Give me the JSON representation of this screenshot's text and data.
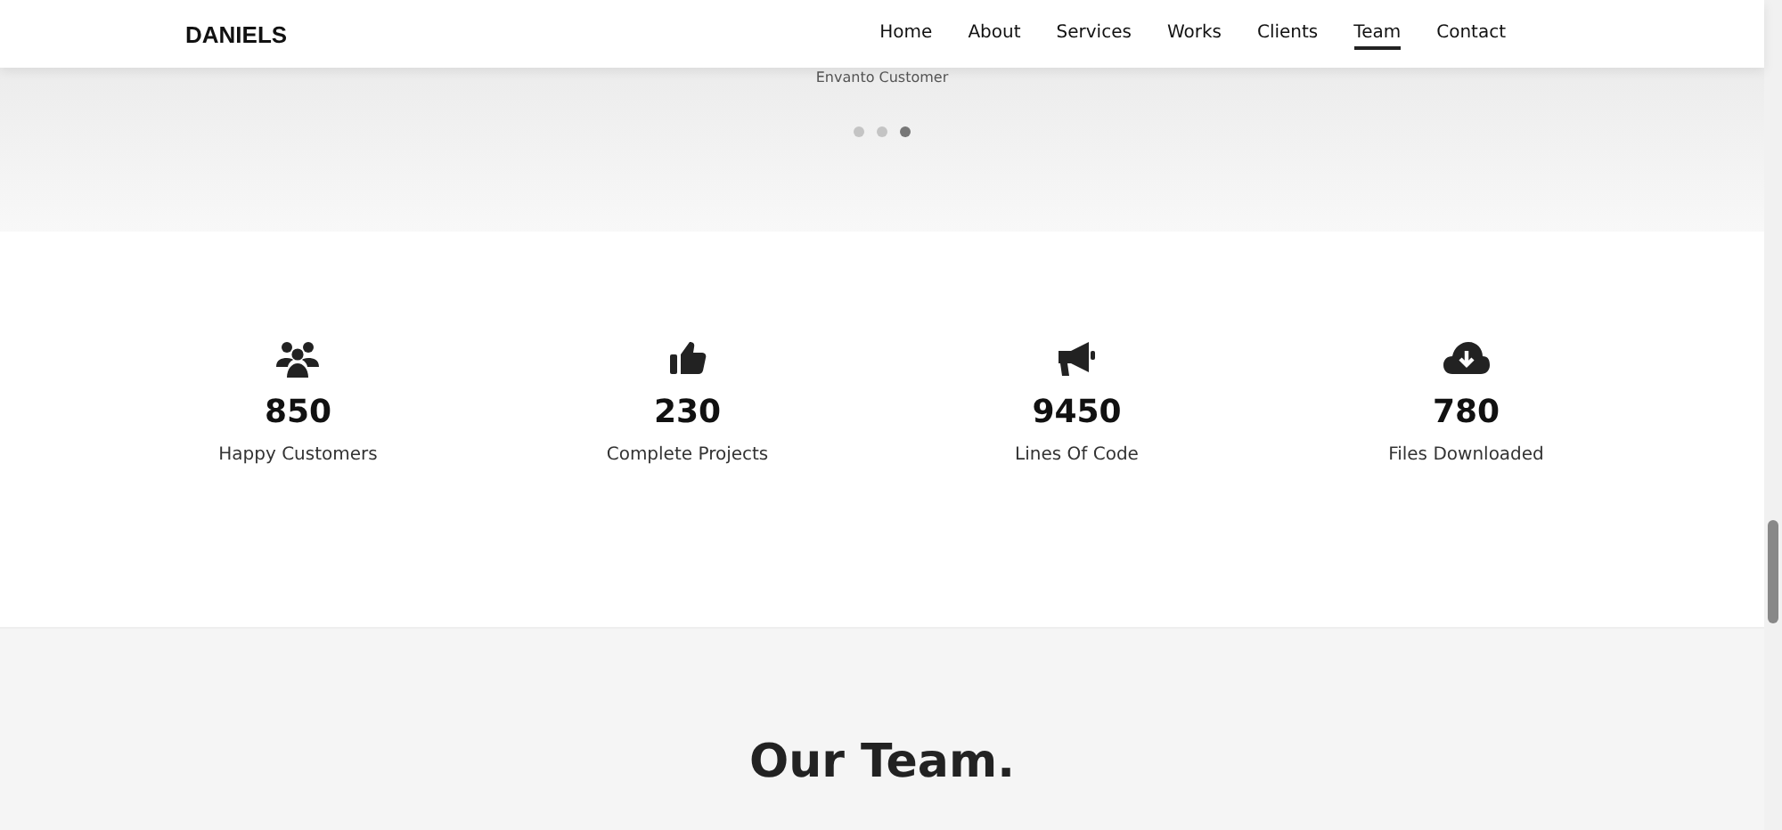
{
  "nav": {
    "logo": "DANIELS",
    "links": [
      {
        "label": "Home",
        "selected": false
      },
      {
        "label": "About",
        "selected": false
      },
      {
        "label": "Services",
        "selected": false
      },
      {
        "label": "Works",
        "selected": false
      },
      {
        "label": "Clients",
        "selected": false
      },
      {
        "label": "Team",
        "selected": true
      },
      {
        "label": "Contact",
        "selected": false
      }
    ]
  },
  "testimonial": {
    "author_role": "Envanto Customer",
    "dots": [
      {
        "selected": false
      },
      {
        "selected": false
      },
      {
        "selected": true
      }
    ]
  },
  "counters": [
    {
      "kind": "people",
      "value": "850",
      "label": "Happy Customers"
    },
    {
      "kind": "thumb",
      "value": "230",
      "label": "Complete Projects"
    },
    {
      "kind": "megaphone",
      "value": "9450",
      "label": "Lines Of Code"
    },
    {
      "kind": "cloud",
      "value": "780",
      "label": "Files Downloaded"
    }
  ],
  "team": {
    "title": "Our Team."
  }
}
